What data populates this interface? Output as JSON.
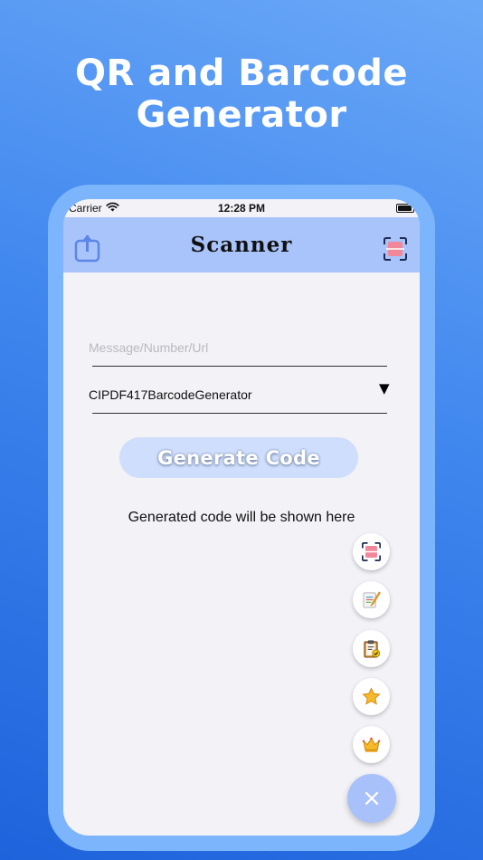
{
  "hero": {
    "title_line1": "QR and Barcode",
    "title_line2": "Generator"
  },
  "status_bar": {
    "carrier": "Carrier",
    "time": "12:28 PM"
  },
  "nav": {
    "title": "Scanner",
    "share_icon": "share-icon",
    "scan_icon": "scan-icon"
  },
  "form": {
    "input_placeholder": "Message/Number/Url",
    "input_value": "",
    "selected_generator": "CIPDF417BarcodeGenerator",
    "dropdown_arrow": "▼",
    "generate_label": "Generate Code"
  },
  "result": {
    "placeholder_text": "Generated code will be shown here"
  },
  "fab_menu": {
    "items": [
      {
        "icon": "scan-icon"
      },
      {
        "icon": "notes-icon"
      },
      {
        "icon": "clipboard-icon"
      },
      {
        "icon": "star-icon"
      },
      {
        "icon": "crown-icon"
      }
    ],
    "close_label": "×"
  },
  "colors": {
    "background_top": "#6aa8f7",
    "background_bottom": "#1f63dc",
    "frame": "#7cb5fb",
    "nav_bar": "#a9c4fb",
    "screen_bg": "#f2f2f7",
    "button_bg": "#cfdefc",
    "fab_close_bg": "#a8c1fb"
  }
}
